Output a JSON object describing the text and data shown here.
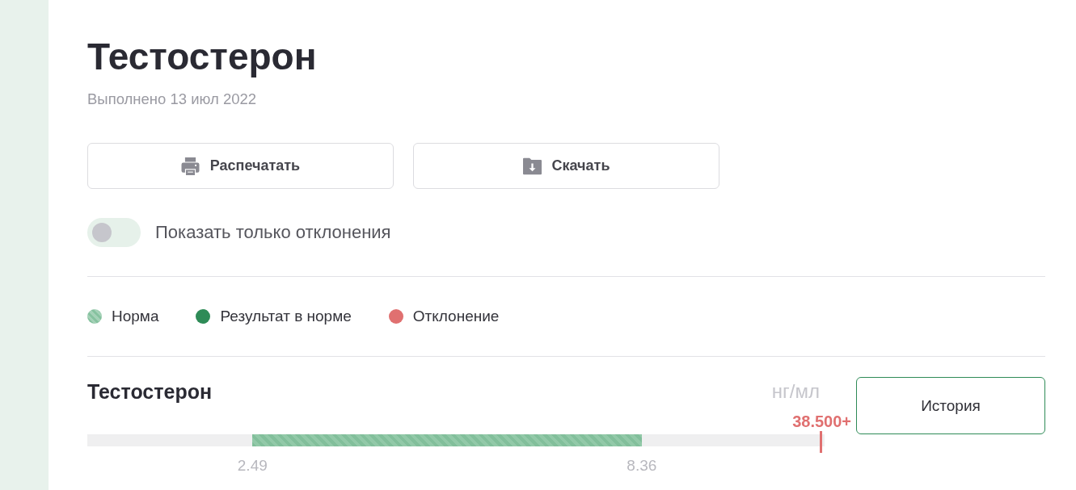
{
  "title": "Тестостерон",
  "subtitle": "Выполнено 13 июл 2022",
  "actions": [
    {
      "kind": "print",
      "label": "Распечатать"
    },
    {
      "kind": "download",
      "label": "Скачать"
    }
  ],
  "filter_toggle": {
    "label": "Показать только отклонения",
    "on": false
  },
  "legend": [
    {
      "kind": "striped",
      "label": "Норма",
      "color": "#86c29f"
    },
    {
      "kind": "solid",
      "label": "Результат в норме",
      "color": "#2e8b57"
    },
    {
      "kind": "solid",
      "label": "Отклонение",
      "color": "#e07070"
    }
  ],
  "results": [
    {
      "name": "Тестостерон",
      "unit": "нг/мл",
      "value": "38.500+",
      "abnormal": true,
      "level": 0.996,
      "norm": {
        "from": {
          "label": "2.49",
          "level": 0.224
        },
        "to": {
          "label": "8.36",
          "level": 0.752
        }
      },
      "history_button": "История"
    }
  ]
}
